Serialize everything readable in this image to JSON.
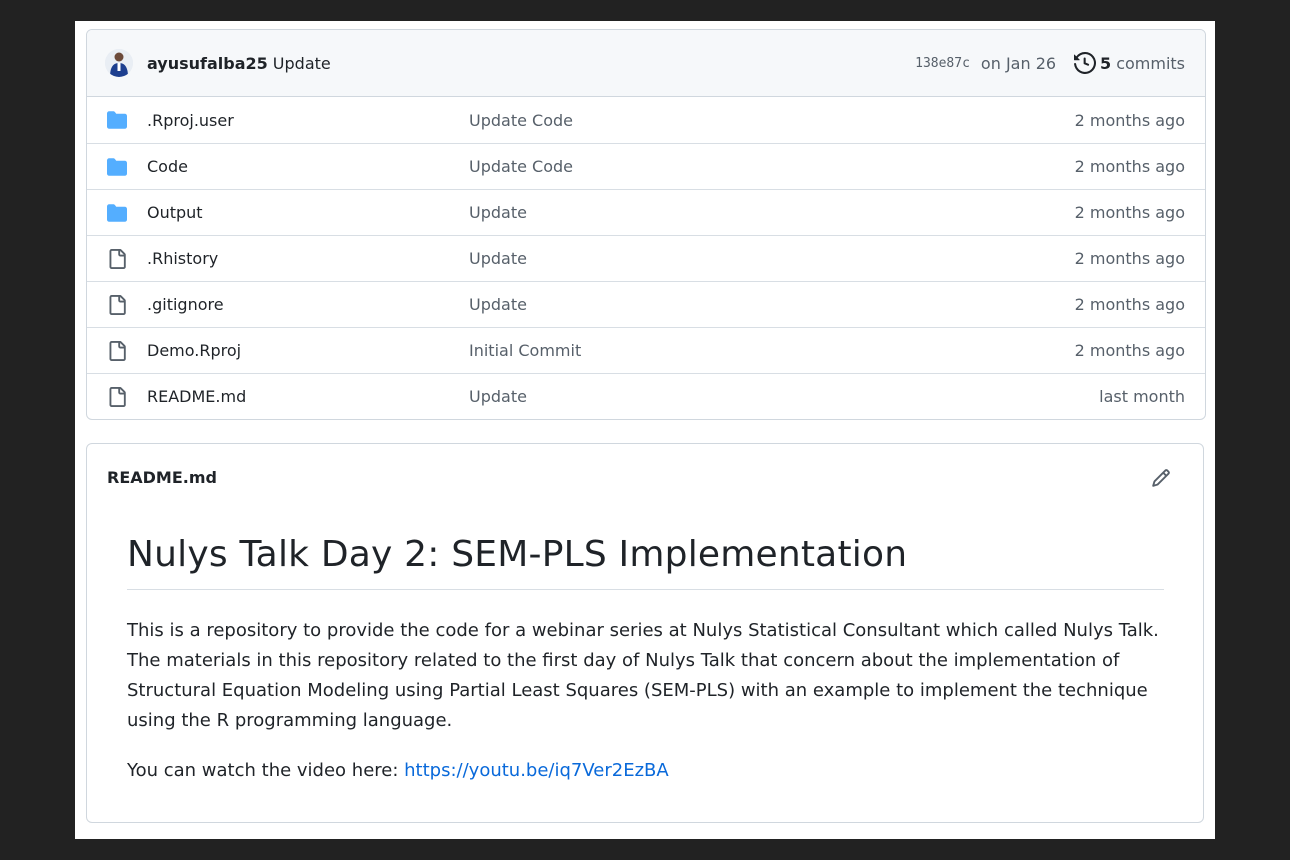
{
  "commit": {
    "author": "ayusufalba25",
    "message": "Update",
    "sha": "138e87c",
    "date": "on Jan 26",
    "count": "5",
    "count_label": "commits"
  },
  "files": [
    {
      "name": ".Rproj.user",
      "type": "folder",
      "message": "Update Code",
      "date": "2 months ago"
    },
    {
      "name": "Code",
      "type": "folder",
      "message": "Update Code",
      "date": "2 months ago"
    },
    {
      "name": "Output",
      "type": "folder",
      "message": "Update",
      "date": "2 months ago"
    },
    {
      "name": ".Rhistory",
      "type": "file",
      "message": "Update",
      "date": "2 months ago"
    },
    {
      "name": ".gitignore",
      "type": "file",
      "message": "Update",
      "date": "2 months ago"
    },
    {
      "name": "Demo.Rproj",
      "type": "file",
      "message": "Initial Commit",
      "date": "2 months ago"
    },
    {
      "name": "README.md",
      "type": "file",
      "message": "Update",
      "date": "last month"
    }
  ],
  "readme": {
    "filename": "README.md",
    "title": "Nulys Talk Day 2: SEM-PLS Implementation",
    "paragraph": "This is a repository to provide the code for a webinar series at Nulys Statistical Consultant which called Nulys Talk. The materials in this repository related to the first day of Nulys Talk that concern about the implementation of Structural Equation Modeling using Partial Least Squares (SEM-PLS) with an example to implement the technique using the R programming language.",
    "video_prefix": "You can watch the video here: ",
    "video_link": "https://youtu.be/iq7Ver2EzBA"
  },
  "icons": {
    "folder": "folder-icon",
    "file": "file-icon",
    "history": "history-icon",
    "edit": "pencil-icon"
  },
  "colors": {
    "folder": "#54aeff",
    "link": "#0969da",
    "muted": "#57606a",
    "border": "#d0d7de"
  }
}
